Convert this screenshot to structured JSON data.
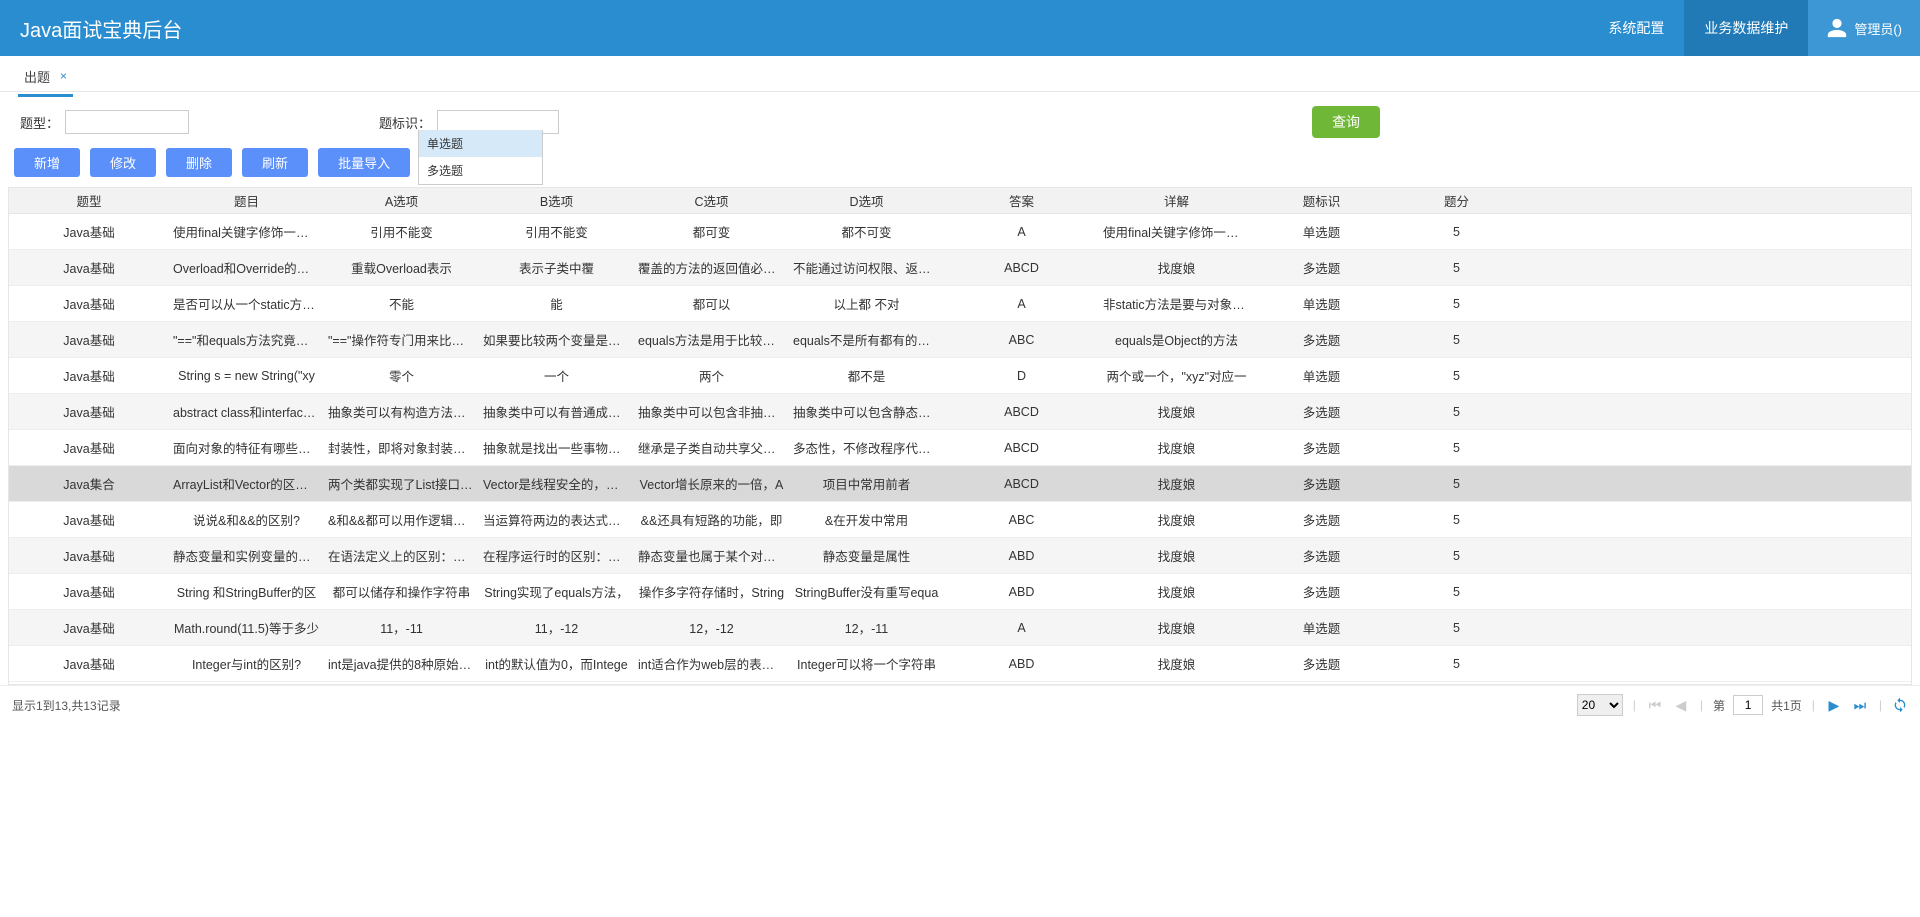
{
  "app": {
    "title": "Java面试宝典后台"
  },
  "topnav": {
    "items": [
      {
        "label": "系统配置",
        "active": false
      },
      {
        "label": "业务数据维护",
        "active": true
      }
    ],
    "user": "管理员()"
  },
  "tabs": [
    {
      "label": "出题",
      "active": true
    }
  ],
  "filters": {
    "type_label": "题型：",
    "type_value": "",
    "tag_label": "题标识：",
    "tag_value": "",
    "query_btn": "查询",
    "suggestions": [
      {
        "label": "单选题",
        "hover": true
      },
      {
        "label": "多选题",
        "hover": false
      }
    ]
  },
  "actions": [
    {
      "label": "新增"
    },
    {
      "label": "修改"
    },
    {
      "label": "删除"
    },
    {
      "label": "刷新"
    },
    {
      "label": "批量导入"
    }
  ],
  "columns": [
    "题型",
    "题目",
    "A选项",
    "B选项",
    "C选项",
    "D选项",
    "答案",
    "详解",
    "题标识",
    "题分"
  ],
  "rows": [
    {
      "c": [
        "Java基础",
        "使用final关键字修饰一个变",
        "引用不能变",
        "引用不能变",
        "都可变",
        "都不可变",
        "A",
        "使用final关键字修饰一个变",
        "单选题",
        "5"
      ],
      "hover": false
    },
    {
      "c": [
        "Java基础",
        "Overload和Override的区别",
        "重载Overload表示",
        "表示子类中覆",
        "覆盖的方法的返回值必须和",
        "不能通过访问权限、返回类",
        "ABCD",
        "找度娘",
        "多选题",
        "5"
      ],
      "hover": false
    },
    {
      "c": [
        "Java基础",
        "是否可以从一个static方法内",
        "不能",
        "能",
        "都可以",
        "以上都 不对",
        "A",
        "非static方法是要与对象关联",
        "单选题",
        "5"
      ],
      "hover": false
    },
    {
      "c": [
        "Java基础",
        "\"==\"和equals方法究竟有什",
        "\"==\"操作符专门用来比较两",
        "如果要比较两个变量是否指",
        "equals方法是用于比较两个",
        "equals不是所有都有的方法",
        "ABC",
        "equals是Object的方法",
        "多选题",
        "5"
      ],
      "hover": false
    },
    {
      "c": [
        "Java基础",
        "String s = new String(\"xy",
        "零个",
        "一个",
        "两个",
        "都不是",
        "D",
        "两个或一个，\"xyz\"对应一",
        "单选题",
        "5"
      ],
      "hover": false
    },
    {
      "c": [
        "Java基础",
        "abstract class和interface的",
        "抽象类可以有构造方法，接",
        "抽象类中可以有普通成员变",
        "抽象类中可以包含非抽象的",
        "抽象类中可以包含静态方法",
        "ABCD",
        "找度娘",
        "多选题",
        "5"
      ],
      "hover": false
    },
    {
      "c": [
        "Java基础",
        "面向对象的特征有哪些方面",
        "封装性，即将对象封装成一",
        "抽象就是找出一些事物的相",
        "继承是子类自动共享父类数",
        "多态性，不修改程序代码就",
        "ABCD",
        "找度娘",
        "多选题",
        "5"
      ],
      "hover": false
    },
    {
      "c": [
        "Java集合",
        "ArrayList和Vector的区别？",
        "两个类都实现了List接口，仆",
        "Vector是线程安全的，也就",
        "Vector增长原来的一倍，A",
        "项目中常用前者",
        "ABCD",
        "找度娘",
        "多选题",
        "5"
      ],
      "hover": true
    },
    {
      "c": [
        "Java基础",
        "说说&和&&的区别?",
        "&和&&都可以用作逻辑与的",
        "当运算符两边的表达式的结",
        "&&还具有短路的功能，即",
        "&在开发中常用",
        "ABC",
        "找度娘",
        "多选题",
        "5"
      ],
      "hover": false
    },
    {
      "c": [
        "Java基础",
        "静态变量和实例变量的区别",
        "在语法定义上的区别：静态",
        "在程序运行时的区别：实例",
        "静态变量也属于某个对象的",
        "静态变量是属性",
        "ABD",
        "找度娘",
        "多选题",
        "5"
      ],
      "hover": false
    },
    {
      "c": [
        "Java基础",
        "String 和StringBuffer的区",
        "都可以储存和操作字符串",
        "String实现了equals方法，",
        "操作多字符存储时，String",
        "StringBuffer没有重写equa",
        "ABD",
        "找度娘",
        "多选题",
        "5"
      ],
      "hover": false
    },
    {
      "c": [
        "Java基础",
        "Math.round(11.5)等于多少",
        "11，-11",
        "11，-12",
        "12，-12",
        "12，-11",
        "A",
        "找度娘",
        "单选题",
        "5"
      ],
      "hover": false
    },
    {
      "c": [
        "Java基础",
        "Integer与int的区别?",
        "int是java提供的8种原始数据",
        "int的默认值为0，而Intege",
        "int适合作为web层的表单数",
        "Integer可以将一个字符串",
        "ABD",
        "找度娘",
        "多选题",
        "5"
      ],
      "hover": false
    }
  ],
  "footer": {
    "summary": "显示1到13,共13记录",
    "page_size": "20",
    "page": "1",
    "page_label_prefix": "第",
    "page_label_suffix": "共1页"
  }
}
